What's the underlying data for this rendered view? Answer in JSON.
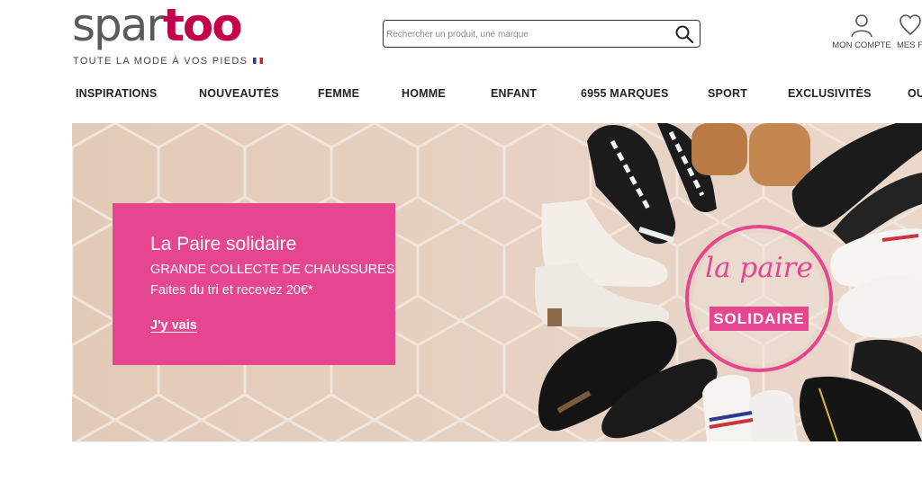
{
  "header": {
    "logo": {
      "part1": "spar",
      "part2": "too"
    },
    "tagline": "TOUTE LA MODE À VOS PIEDS",
    "search_placeholder": "Rechercher un produit, une marque",
    "account_label": "MON COMPTE",
    "favorites_label": "MES FAVORIS"
  },
  "nav": {
    "items": [
      "INSPIRATIONS",
      "NOUVEAUTÉS",
      "FEMME",
      "HOMME",
      "ENFANT",
      "6955 MARQUES",
      "SPORT",
      "EXCLUSIVITÉS",
      "OUTLET"
    ]
  },
  "banner": {
    "title": "La Paire solidaire",
    "subtitle": "GRANDE COLLECTE DE CHAUSSURES",
    "subtitle2": "Faites du tri et recevez 20€*",
    "cta": "J'y vais",
    "stamp_script": "la paire",
    "stamp_label": "SOLIDAIRE"
  },
  "colors": {
    "brand": "#c4004d",
    "promo": "#e5468f",
    "background": "#e4cfc0"
  }
}
